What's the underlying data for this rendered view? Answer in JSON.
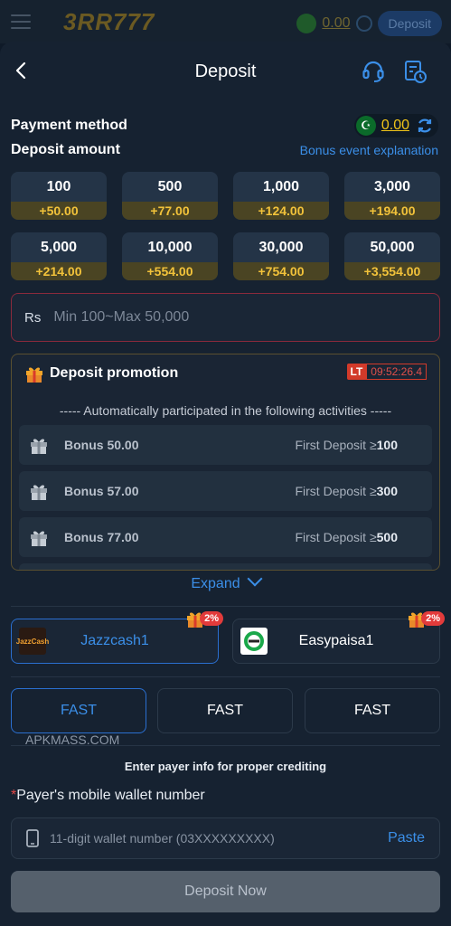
{
  "background": {
    "logo": "3RR777",
    "balance": "0.00",
    "deposit_label": "Deposit"
  },
  "header": {
    "title": "Deposit"
  },
  "payment_method": {
    "label": "Payment method",
    "balance": "0.00"
  },
  "deposit_amount": {
    "label": "Deposit amount",
    "bonus_link": "Bonus event explanation",
    "options": [
      {
        "amount": "100",
        "bonus": "+50.00"
      },
      {
        "amount": "500",
        "bonus": "+77.00"
      },
      {
        "amount": "1,000",
        "bonus": "+124.00"
      },
      {
        "amount": "3,000",
        "bonus": "+194.00"
      },
      {
        "amount": "5,000",
        "bonus": "+214.00"
      },
      {
        "amount": "10,000",
        "bonus": "+554.00"
      },
      {
        "amount": "30,000",
        "bonus": "+754.00"
      },
      {
        "amount": "50,000",
        "bonus": "+3,554.00"
      }
    ],
    "currency": "Rs",
    "placeholder": "Min 100~Max 50,000"
  },
  "promotion": {
    "title": "Deposit promotion",
    "timer_badge": "LT",
    "timer": "09:52:26.4",
    "auto_text": "----- Automatically participated in the following activities -----",
    "items": [
      {
        "bonus": "Bonus  50.00",
        "condition": "First Deposit ≥",
        "threshold": "100"
      },
      {
        "bonus": "Bonus  57.00",
        "condition": "First Deposit ≥",
        "threshold": "300"
      },
      {
        "bonus": "Bonus  77.00",
        "condition": "First Deposit ≥",
        "threshold": "500"
      }
    ],
    "expand_label": "Expand"
  },
  "channels": [
    {
      "name": "Jazzcash1",
      "badge": "2%",
      "logo_text": "JazzCash"
    },
    {
      "name": "Easypaisa1",
      "badge": "2%"
    }
  ],
  "speeds": [
    "FAST",
    "FAST",
    "FAST"
  ],
  "watermark": "APKMASS.COM",
  "payer": {
    "hint": "Enter payer info for proper crediting",
    "required_mark": "*",
    "label": "Payer's mobile wallet number",
    "placeholder": "11-digit wallet number (03XXXXXXXXX)",
    "paste": "Paste"
  },
  "submit_label": "Deposit Now",
  "colors": {
    "accent": "#3b8fe8",
    "bonus_gold": "#f2c23a",
    "background": "#162231"
  }
}
